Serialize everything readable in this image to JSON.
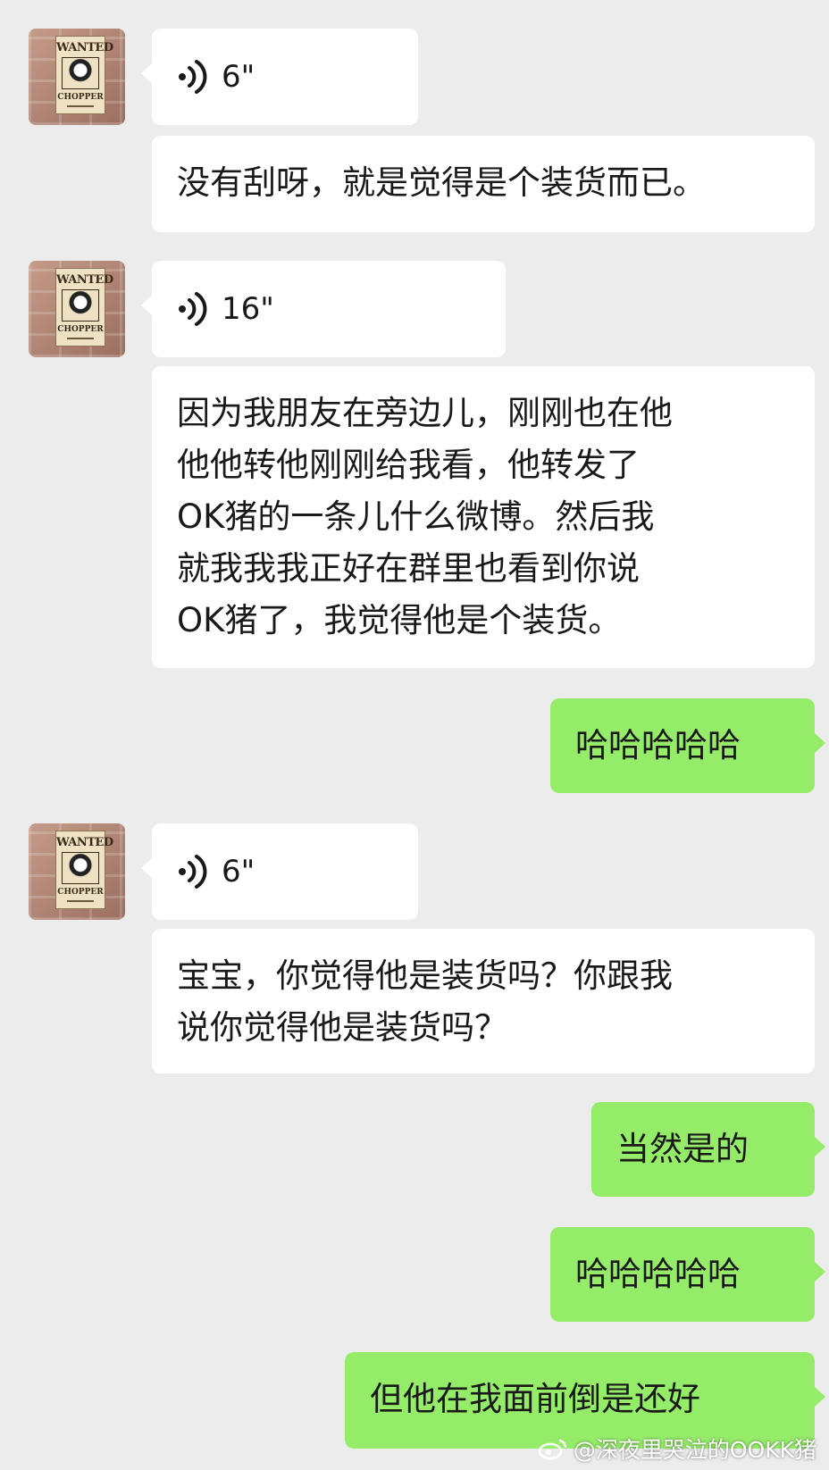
{
  "chat": {
    "messages": [
      {
        "duration": "6\""
      },
      {
        "text": "没有刮呀，就是觉得是个装货而已。"
      },
      {
        "duration": "16\""
      },
      {
        "text": "因为我朋友在旁边儿，刚刚也在他\n他他转他刚刚给我看，他转发了\nOK猪的一条儿什么微博。然后我\n就我我我正好在群里也看到你说\nOK猪了，我觉得他是个装货。"
      },
      {
        "text": "哈哈哈哈哈"
      },
      {
        "duration": "6\""
      },
      {
        "text": "宝宝，你觉得他是装货吗？你跟我\n说你觉得他是装货吗？"
      },
      {
        "text": "当然是的"
      },
      {
        "text": "哈哈哈哈哈"
      },
      {
        "text": "但他在我面前倒是还好"
      }
    ]
  },
  "avatar": {
    "poster_top": "WANTED",
    "poster_name": "CHOPPER"
  },
  "watermark": {
    "text": "@深夜里哭泣的OOKK猪"
  },
  "colors": {
    "background": "#ececec",
    "incoming": "#ffffff",
    "outgoing": "#95ec69"
  }
}
